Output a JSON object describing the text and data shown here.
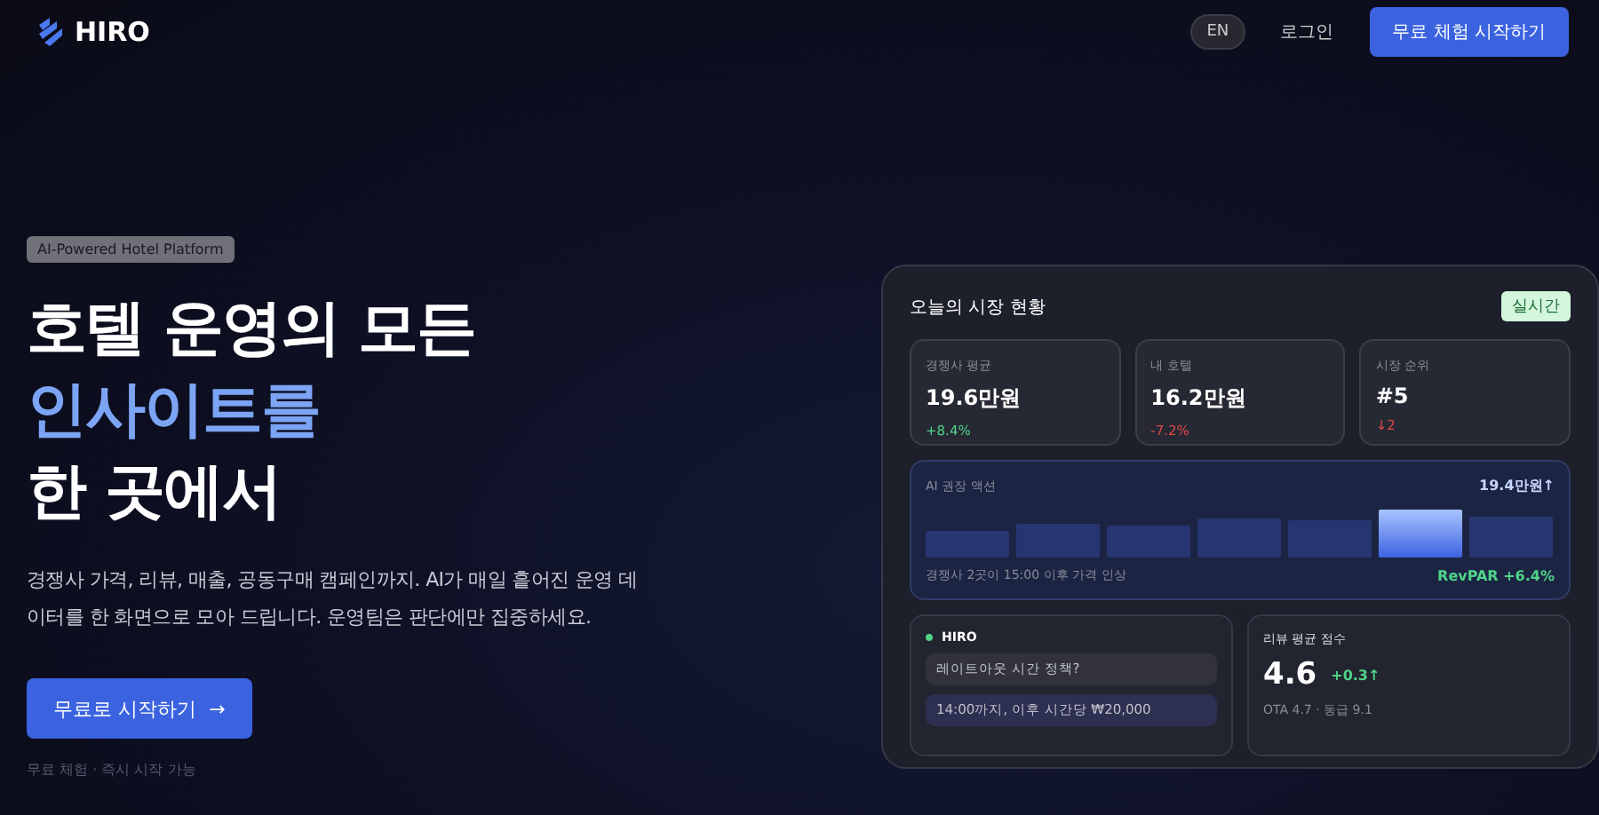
{
  "nav": {
    "brand": "HIRO",
    "language": "EN",
    "login": "로그인",
    "cta": "무료 체험 시작하기"
  },
  "hero": {
    "badge": "AI-Powered Hotel Platform",
    "title_lines": [
      {
        "text": "호텔 운영의 모든",
        "accent": false
      },
      {
        "text": "인사이트를",
        "accent": true
      },
      {
        "text": "한 곳에서",
        "accent": false
      }
    ],
    "description": "경쟁사 가격, 리뷰, 매출, 공동구매 캠페인까지. AI가 매일 흩어진 운영 데이터를 한 화면으로 모아 드립니다. 운영팀은 판단에만 집중하세요.",
    "button": "무료로 시작하기",
    "button_arrow": "→",
    "note": "무료 체험 · 즉시 시작 가능"
  },
  "dashboard": {
    "title": "오늘의 시장 현황",
    "live_badge": "실시간",
    "stats": [
      {
        "label": "경쟁사 평균",
        "value": "19.6만원",
        "change": "+8.4%",
        "rising": true
      },
      {
        "label": "내 호텔",
        "value": "16.2만원",
        "change": "-7.2%",
        "rising": false
      },
      {
        "label": "시장 순위",
        "value": "#5",
        "change": "↓2",
        "rising": false
      }
    ],
    "action": {
      "title": "AI 권장 액션",
      "amount": "19.4만원↑",
      "caption": "경쟁사 2곳이 15:00 이후 가격 인상",
      "metric": "RevPAR +6.4%"
    },
    "chat": {
      "name": "HIRO",
      "question": "레이트아웃 시간 정책?",
      "answer": "14:00까지, 이후 시간당 ₩20,000"
    },
    "review": {
      "title": "리뷰 평균 점수",
      "score": "4.6",
      "change": "+0.3↑",
      "detail": "OTA 4.7 · 동급 9.1"
    }
  }
}
